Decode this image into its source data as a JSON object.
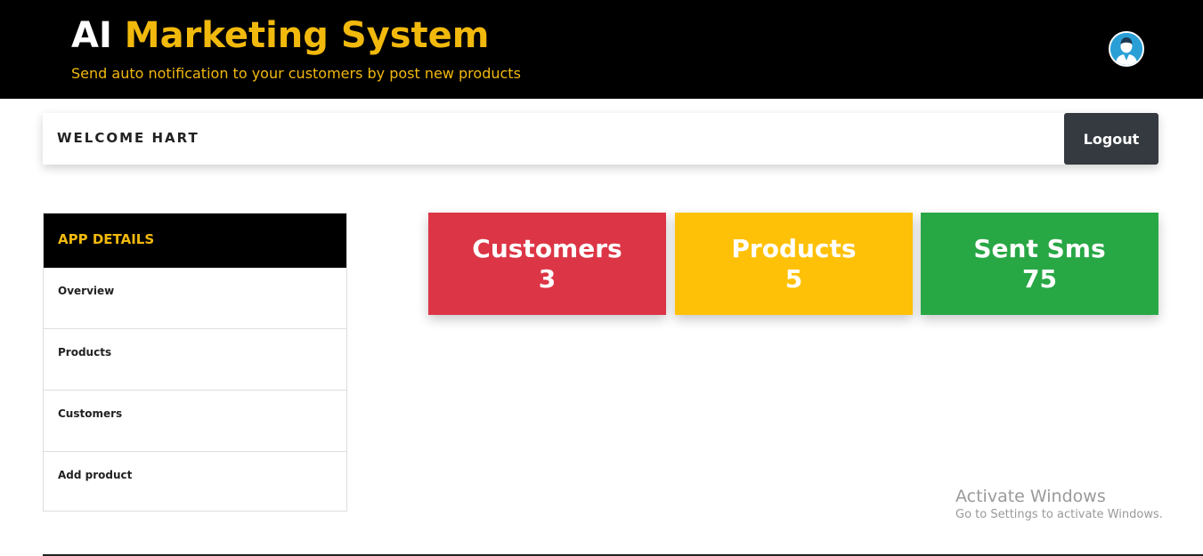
{
  "header": {
    "title_part1": "AI",
    "title_part2": "Marketing System",
    "subtitle": "Send auto notification to your customers by post new products",
    "avatar_icon": "user-avatar-icon"
  },
  "welcome": {
    "text": "WELCOME HART",
    "logout_label": "Logout"
  },
  "sidebar": {
    "header": "APP DETAILS",
    "items": [
      {
        "label": "Overview"
      },
      {
        "label": "Products"
      },
      {
        "label": "Customers"
      },
      {
        "label": "Add product"
      }
    ]
  },
  "stats": [
    {
      "label": "Customers",
      "value": "3",
      "color": "#dc3545"
    },
    {
      "label": "Products",
      "value": "5",
      "color": "#ffc107"
    },
    {
      "label": "Sent Sms",
      "value": "75",
      "color": "#28a745"
    }
  ],
  "colors": {
    "brand_accent": "#f2b90d",
    "header_bg": "#000000",
    "logout_bg": "#343a40"
  },
  "watermark": {
    "title": "Activate Windows",
    "subtitle": "Go to Settings to activate Windows."
  }
}
